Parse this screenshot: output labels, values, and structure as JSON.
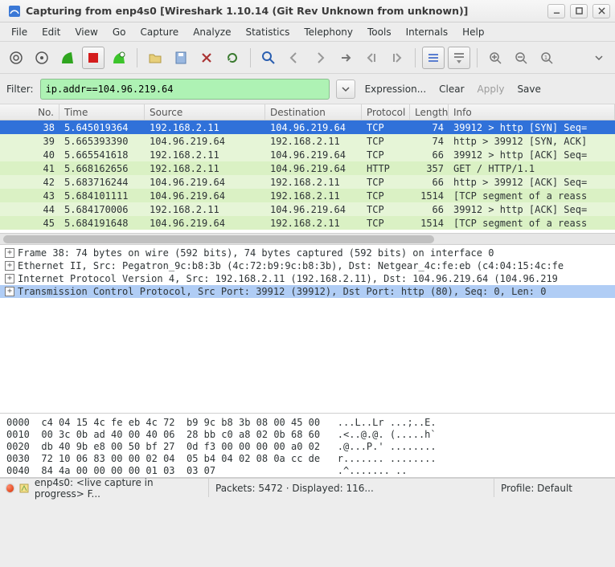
{
  "window": {
    "title": "Capturing from enp4s0    [Wireshark 1.10.14  (Git Rev Unknown from unknown)]"
  },
  "menu": {
    "file": "File",
    "edit": "Edit",
    "view": "View",
    "go": "Go",
    "capture": "Capture",
    "analyze": "Analyze",
    "statistics": "Statistics",
    "telephony": "Telephony",
    "tools": "Tools",
    "internals": "Internals",
    "help": "Help"
  },
  "toolbar_icons": [
    "interfaces-icon",
    "capture-options-icon",
    "start-capture-icon",
    "stop-capture-icon",
    "restart-capture-icon",
    "sep",
    "open-file-icon",
    "save-file-icon",
    "close-file-icon",
    "reload-icon",
    "sep",
    "find-icon",
    "go-back-icon",
    "go-forward-icon",
    "go-to-icon",
    "go-first-icon",
    "go-last-icon",
    "sep",
    "colorize-icon",
    "auto-scroll-icon",
    "sep",
    "zoom-in-icon",
    "zoom-out-icon",
    "zoom-reset-icon",
    "sep",
    "more-icon"
  ],
  "filter": {
    "label": "Filter:",
    "value": "ip.addr==104.96.219.64",
    "expression": "Expression...",
    "clear": "Clear",
    "apply": "Apply",
    "save": "Save"
  },
  "columns": {
    "no": "No.",
    "time": "Time",
    "source": "Source",
    "destination": "Destination",
    "protocol": "Protocol",
    "length": "Length",
    "info": "Info"
  },
  "packets": [
    {
      "no": "38",
      "time": "5.645019364",
      "src": "192.168.2.11",
      "dst": "104.96.219.64",
      "proto": "TCP",
      "len": "74",
      "info": "39912 > http [SYN] Seq=",
      "cls": "selected"
    },
    {
      "no": "39",
      "time": "5.665393390",
      "src": "104.96.219.64",
      "dst": "192.168.2.11",
      "proto": "TCP",
      "len": "74",
      "info": "http > 39912 [SYN, ACK]",
      "cls": "green-light"
    },
    {
      "no": "40",
      "time": "5.665541618",
      "src": "192.168.2.11",
      "dst": "104.96.219.64",
      "proto": "TCP",
      "len": "66",
      "info": "39912 > http [ACK] Seq=",
      "cls": "green-light"
    },
    {
      "no": "41",
      "time": "5.668162656",
      "src": "192.168.2.11",
      "dst": "104.96.219.64",
      "proto": "HTTP",
      "len": "357",
      "info": "GET / HTTP/1.1",
      "cls": "green-mid"
    },
    {
      "no": "42",
      "time": "5.683716244",
      "src": "104.96.219.64",
      "dst": "192.168.2.11",
      "proto": "TCP",
      "len": "66",
      "info": "http > 39912 [ACK] Seq=",
      "cls": "green-light"
    },
    {
      "no": "43",
      "time": "5.684101111",
      "src": "104.96.219.64",
      "dst": "192.168.2.11",
      "proto": "TCP",
      "len": "1514",
      "info": "[TCP segment of a reass",
      "cls": "green-mid"
    },
    {
      "no": "44",
      "time": "5.684170006",
      "src": "192.168.2.11",
      "dst": "104.96.219.64",
      "proto": "TCP",
      "len": "66",
      "info": "39912 > http [ACK] Seq=",
      "cls": "green-light"
    },
    {
      "no": "45",
      "time": "5.684191648",
      "src": "104.96.219.64",
      "dst": "192.168.2.11",
      "proto": "TCP",
      "len": "1514",
      "info": "[TCP segment of a reass",
      "cls": "green-mid"
    }
  ],
  "details": {
    "line1": "Frame 38: 74 bytes on wire (592 bits), 74 bytes captured (592 bits) on interface 0",
    "line2": "Ethernet II, Src: Pegatron_9c:b8:3b (4c:72:b9:9c:b8:3b), Dst: Netgear_4c:fe:eb (c4:04:15:4c:fe",
    "line3": "Internet Protocol Version 4, Src: 192.168.2.11 (192.168.2.11), Dst: 104.96.219.64 (104.96.219",
    "line4": "Transmission Control Protocol, Src Port: 39912 (39912), Dst Port: http (80), Seq: 0, Len: 0"
  },
  "hex": {
    "l1": "0000  c4 04 15 4c fe eb 4c 72  b9 9c b8 3b 08 00 45 00   ...L..Lr ...;..E.",
    "l2": "0010  00 3c 0b ad 40 00 40 06  28 bb c0 a8 02 0b 68 60   .<..@.@. (.....h`",
    "l3": "0020  db 40 9b e8 00 50 bf 27  0d f3 00 00 00 00 a0 02   .@...P.' ........",
    "l4": "0030  72 10 06 83 00 00 02 04  05 b4 04 02 08 0a cc de   r....... ........",
    "l5": "0040  84 4a 00 00 00 00 01 03  03 07                     .^....... .."
  },
  "status": {
    "iface": "enp4s0: <live capture in progress> F...",
    "packets": "Packets: 5472 · Displayed: 116...",
    "profile": "Profile: Default"
  }
}
